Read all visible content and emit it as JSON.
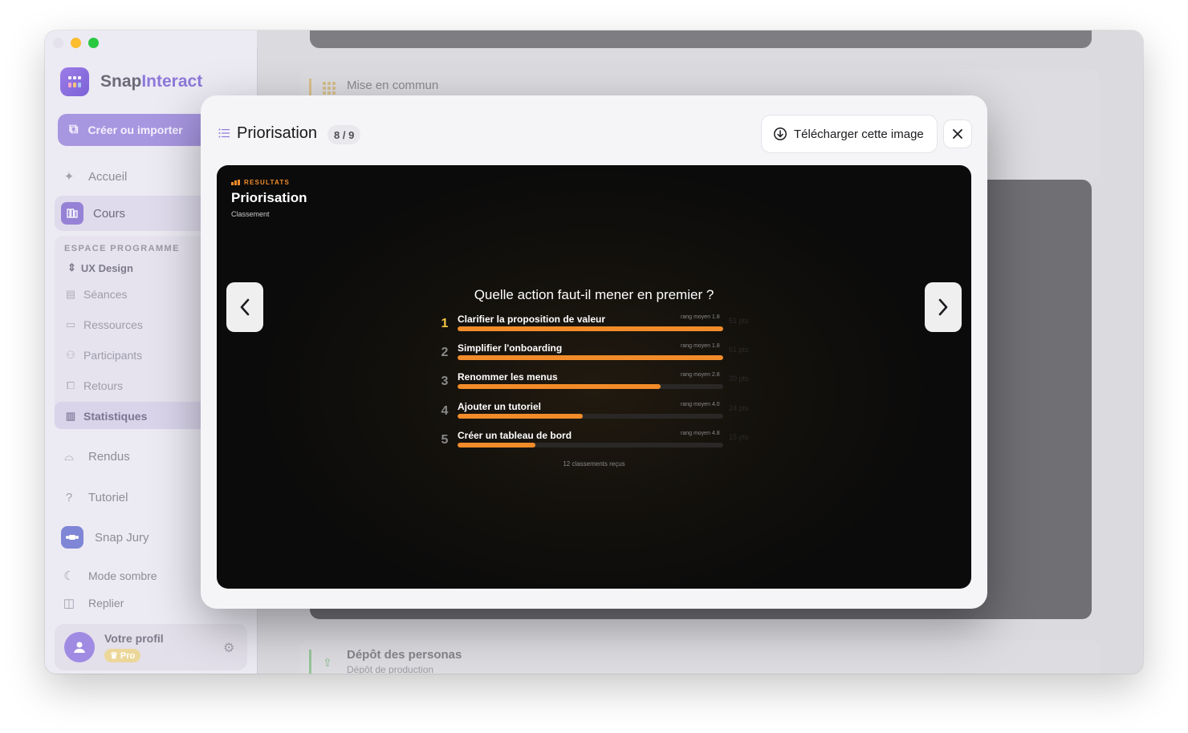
{
  "app": {
    "brand_part1": "Snap",
    "brand_part2": "Interact",
    "colors": {
      "accent": "#8d78d9",
      "orange": "#f28c2a",
      "gold": "#f5c542"
    }
  },
  "sidebar": {
    "create_label": "Créer ou importer",
    "home_label": "Accueil",
    "cours_label": "Cours",
    "program_heading": "ESPACE PROGRAMME",
    "program_selected": "UX Design",
    "sub_items": [
      {
        "label": "Séances",
        "icon": "calendar-icon"
      },
      {
        "label": "Ressources",
        "icon": "folder-icon"
      },
      {
        "label": "Participants",
        "icon": "users-icon"
      },
      {
        "label": "Retours",
        "icon": "feedback-icon"
      },
      {
        "label": "Statistiques",
        "icon": "bar-chart-icon"
      }
    ],
    "rendus_label": "Rendus",
    "tutoriel_label": "Tutoriel",
    "jury_label": "Snap Jury",
    "dark_mode_label": "Mode sombre",
    "collapse_label": "Replier",
    "profile_name": "Votre profil",
    "profile_badge": "Pro"
  },
  "main": {
    "section_title": "Mise en commun",
    "depot_title": "Dépôt des personas",
    "depot_subtitle": "Dépôt de production"
  },
  "modal": {
    "title": "Priorisation",
    "counter": "8 / 9",
    "download_label": "Télécharger cette image",
    "slide": {
      "tag": "RESULTATS",
      "title": "Priorisation",
      "subtitle": "Classement",
      "question": "Quelle action faut-il mener en premier ?",
      "footer": "12 classements reçus",
      "items": [
        {
          "rank": "1",
          "label": "Clarifier la proposition de valeur",
          "meta": "rang moyen 1.8",
          "pts": "51 pts",
          "ratio": 1.0
        },
        {
          "rank": "2",
          "label": "Simplifier l'onboarding",
          "meta": "rang moyen 1.8",
          "pts": "51 pts",
          "ratio": 1.0
        },
        {
          "rank": "3",
          "label": "Renommer les menus",
          "meta": "rang moyen 2.8",
          "pts": "39 pts",
          "ratio": 0.765
        },
        {
          "rank": "4",
          "label": "Ajouter un tutoriel",
          "meta": "rang moyen 4.0",
          "pts": "24 pts",
          "ratio": 0.471
        },
        {
          "rank": "5",
          "label": "Créer un tableau de bord",
          "meta": "rang moyen 4.8",
          "pts": "15 pts",
          "ratio": 0.294
        }
      ]
    }
  }
}
